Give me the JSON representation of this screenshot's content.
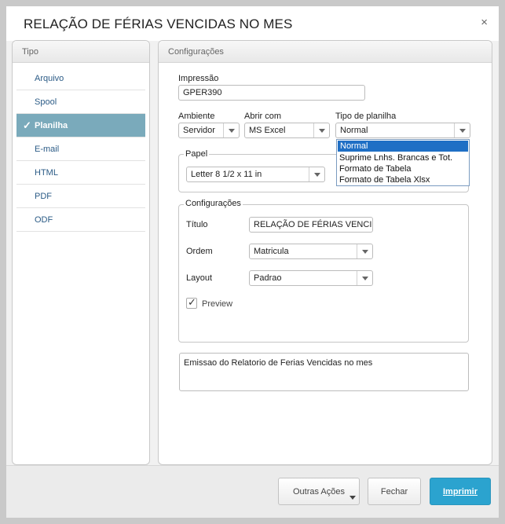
{
  "dialog": {
    "title": "RELAÇÃO DE FÉRIAS VENCIDAS NO MES",
    "close_glyph": "×"
  },
  "tipo": {
    "header": "Tipo",
    "check_glyph": "✓",
    "items": [
      {
        "label": "Arquivo"
      },
      {
        "label": "Spool"
      },
      {
        "label": "Planilha",
        "selected": true
      },
      {
        "label": "E-mail"
      },
      {
        "label": "HTML"
      },
      {
        "label": "PDF"
      },
      {
        "label": "ODF"
      }
    ]
  },
  "config": {
    "header": "Configurações",
    "impressao_label": "Impressão",
    "impressao_value": "GPER390",
    "ambiente_label": "Ambiente",
    "ambiente_value": "Servidor",
    "abrir_label": "Abrir com",
    "abrir_value": "MS Excel",
    "tipo_planilha_label": "Tipo de planilha",
    "tipo_planilha_value": "Normal",
    "tipo_planilha_options": [
      "Normal",
      "Suprime Lnhs. Brancas e Tot.",
      "Formato de Tabela",
      "Formato de Tabela Xlsx"
    ],
    "papel_legend": "Papel",
    "papel_value": "Letter 8 1/2 x 11 in",
    "group_legend": "Configurações",
    "titulo_label": "Título",
    "titulo_value": "RELAÇÃO DE FÉRIAS VENCIDA",
    "ordem_label": "Ordem",
    "ordem_value": "Matricula",
    "layout_label": "Layout",
    "layout_value": "Padrao",
    "preview_label": "Preview",
    "preview_checked": true,
    "description": "Emissao do Relatorio de Ferias Vencidas no mes"
  },
  "footer": {
    "outras_acoes": "Outras Ações",
    "fechar": "Fechar",
    "imprimir": "Imprimir"
  }
}
